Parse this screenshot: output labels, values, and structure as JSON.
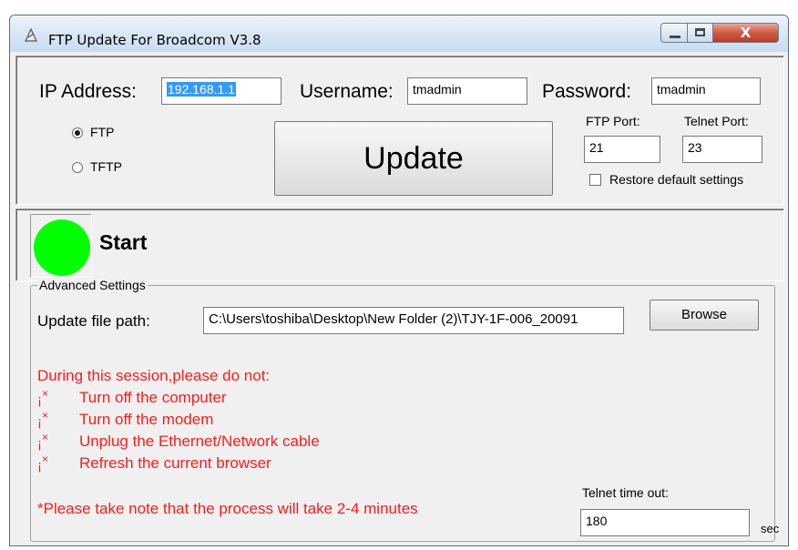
{
  "window": {
    "title": "FTP Update For Broadcom V3.8",
    "close_glyph": "X"
  },
  "connection": {
    "ip_label": "IP Address:",
    "ip_value": "192.168.1.1",
    "username_label": "Username:",
    "username_value": "tmadmin",
    "password_label": "Password:",
    "password_value": "tmadmin"
  },
  "protocol": {
    "ftp_label": "FTP",
    "tftp_label": "TFTP",
    "selected": "FTP"
  },
  "update_button": "Update",
  "ports": {
    "ftp_port_label": "FTP Port:",
    "ftp_port_value": "21",
    "telnet_port_label": "Telnet Port:",
    "telnet_port_value": "23",
    "restore_label": "Restore default settings",
    "restore_checked": false
  },
  "status": {
    "text": "Start",
    "indicator_color": "#00ff00"
  },
  "advanced": {
    "title": "Advanced Settings",
    "file_path_label": "Update file path:",
    "file_path_value": "C:\\Users\\toshiba\\Desktop\\New Folder (2)\\TJY-1F-006_20091",
    "browse_label": "Browse",
    "warning_heading": "During this session,please do not:",
    "bullet_glyph": "¡",
    "bullet_sup": "×",
    "warnings": [
      "Turn off the computer",
      "Turn off the modem",
      "Unplug the Ethernet/Network cable",
      "Refresh the current browser"
    ],
    "note": "*Please take note that the process will take 2-4 minutes",
    "telnet_timeout_label": "Telnet time out:",
    "telnet_timeout_value": "180",
    "timeout_unit": "sec"
  },
  "colors": {
    "warning_text": "#ff1a1a",
    "selection": "#3399ff",
    "status_led": "#00ff00"
  }
}
